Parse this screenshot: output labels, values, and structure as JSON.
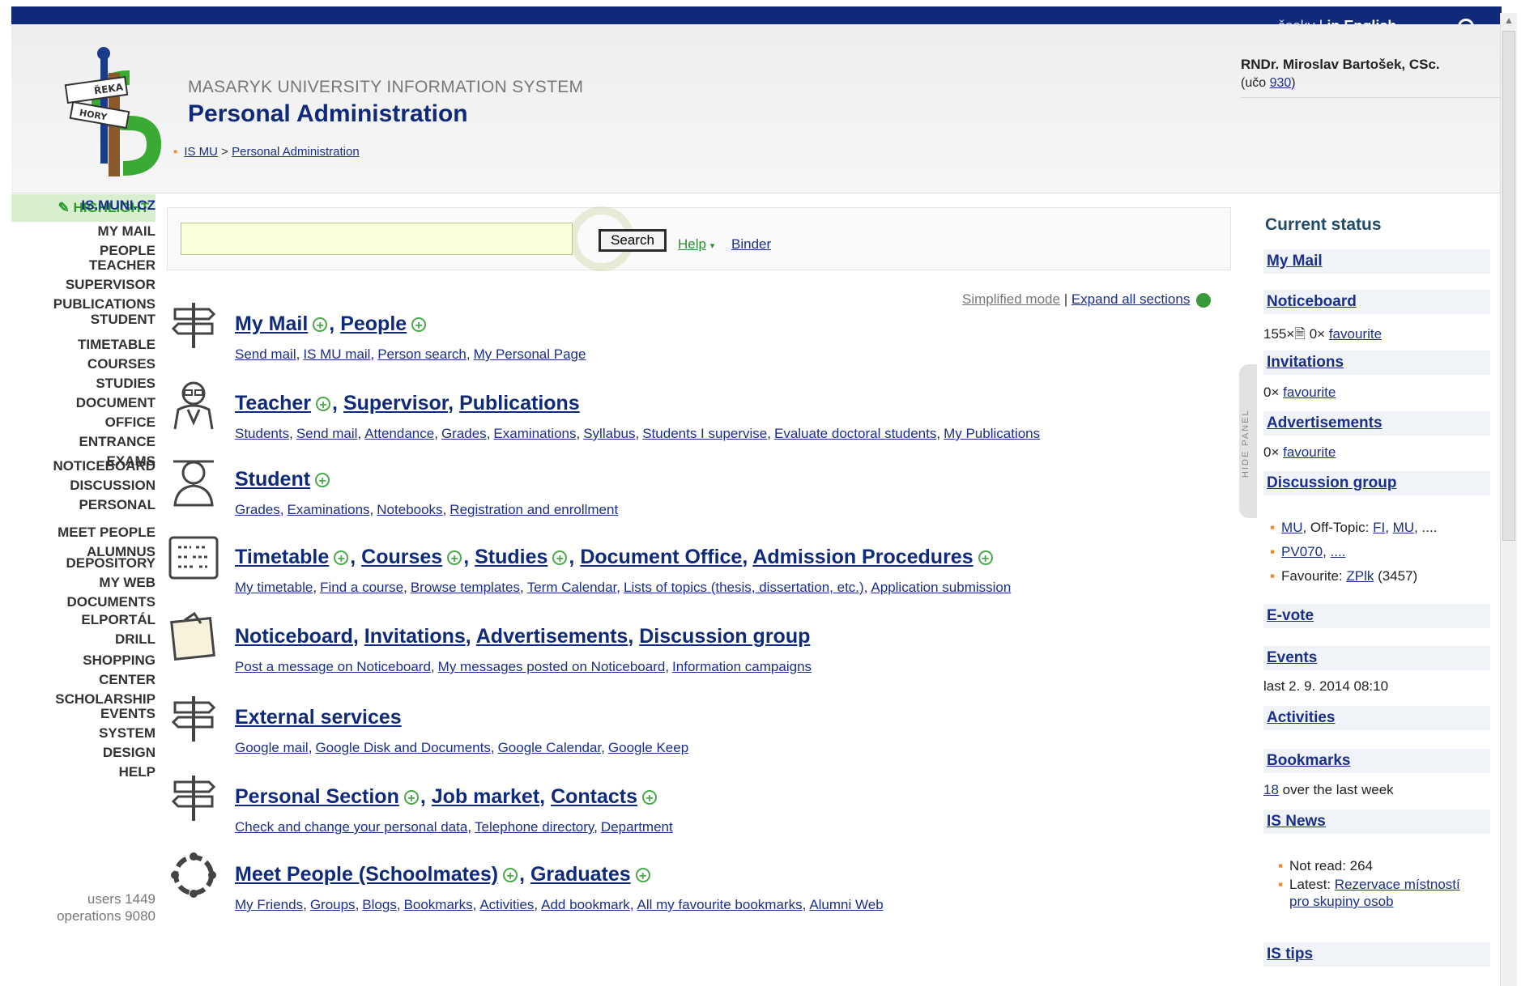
{
  "lang": {
    "czech": "česky",
    "sep": "|",
    "english": "in English"
  },
  "header": {
    "system_title": "MASARYK UNIVERSITY INFORMATION SYSTEM",
    "page_title": "Personal Administration",
    "logo_sign_top": "ŘEKA",
    "logo_sign_bottom": "HORY"
  },
  "breadcrumb": {
    "root": "IS MU",
    "sep": ">",
    "current": "Personal Administration"
  },
  "user": {
    "name": "RNDr. Miroslav Bartošek, CSc.",
    "uco_prefix": "(učo",
    "uco": "930",
    "uco_suffix": ")"
  },
  "leftnav": {
    "highlight": "HIGHLIGHT",
    "groups": [
      [
        "IS.MUNI.CZ"
      ],
      [
        "MY MAIL",
        "PEOPLE"
      ],
      [
        "TEACHER",
        "SUPERVISOR",
        "PUBLICATIONS"
      ],
      [
        "STUDENT"
      ],
      [
        "TIMETABLE",
        "COURSES",
        "STUDIES",
        "DOCUMENT",
        "OFFICE",
        "ENTRANCE",
        "EXAMS"
      ],
      [
        "NOTICEBOARD",
        "DISCUSSION"
      ],
      [
        "PERSONAL"
      ],
      [
        "MEET PEOPLE",
        "ALUMNUS"
      ],
      [
        "DEPOSITORY",
        "MY WEB",
        "DOCUMENTS"
      ],
      [
        "ELPORTÁL",
        "DRILL"
      ],
      [
        "SHOPPING",
        "CENTER",
        "SCHOLARSHIP"
      ],
      [
        "EVENTS",
        "SYSTEM",
        "DESIGN",
        "HELP"
      ]
    ],
    "stats": [
      "users 1449",
      "operations 9080"
    ]
  },
  "search": {
    "placeholder": "",
    "button": "Search",
    "help": "Help",
    "binder": "Binder"
  },
  "mode": {
    "simplified": "Simplified mode",
    "sep": "|",
    "expand": "Expand all sections"
  },
  "sections": [
    {
      "icon": "signpost-icon",
      "titles": [
        {
          "t": "My Mail",
          "plus": true
        },
        {
          "t": "People",
          "plus": true
        }
      ],
      "links": [
        "Send mail",
        "IS MU mail",
        "Person search",
        "My Personal Page"
      ]
    },
    {
      "icon": "teacher-icon",
      "titles": [
        {
          "t": "Teacher",
          "plus": true
        },
        {
          "t": "Supervisor",
          "plus": false
        },
        {
          "t": "Publications",
          "plus": false
        }
      ],
      "links": [
        "Students",
        "Send mail",
        "Attendance",
        "Grades",
        "Examinations",
        "Syllabus",
        "Students I supervise",
        "Evaluate doctoral students",
        "My Publications"
      ]
    },
    {
      "icon": "student-icon",
      "titles": [
        {
          "t": "Student",
          "plus": true
        }
      ],
      "links": [
        "Grades",
        "Examinations",
        "Notebooks",
        "Registration and enrollment"
      ]
    },
    {
      "icon": "timetable-icon",
      "titles": [
        {
          "t": "Timetable",
          "plus": true
        },
        {
          "t": "Courses",
          "plus": true
        },
        {
          "t": "Studies",
          "plus": true
        },
        {
          "t": "Document Office",
          "plus": false
        },
        {
          "t": "Admission Procedures",
          "plus": true
        }
      ],
      "links": [
        "My timetable",
        "Find a course",
        "Browse templates",
        "Term Calendar",
        "Lists of topics (thesis, dissertation, etc.)",
        "Application submission"
      ]
    },
    {
      "icon": "noticeboard-icon",
      "titles": [
        {
          "t": "Noticeboard",
          "plus": false
        },
        {
          "t": "Invitations",
          "plus": false
        },
        {
          "t": "Advertisements",
          "plus": false
        },
        {
          "t": "Discussion group",
          "plus": false
        }
      ],
      "links": [
        "Post a message on Noticeboard",
        "My messages posted on Noticeboard",
        "Information campaigns"
      ]
    },
    {
      "icon": "signpost-icon",
      "titles": [
        {
          "t": "External services",
          "plus": false
        }
      ],
      "links": [
        "Google mail",
        "Google Disk and Documents",
        "Google Calendar",
        "Google Keep"
      ]
    },
    {
      "icon": "signpost-icon",
      "titles": [
        {
          "t": "Personal Section",
          "plus": true
        },
        {
          "t": "Job market",
          "plus": false
        },
        {
          "t": "Contacts",
          "plus": true
        }
      ],
      "links": [
        "Check and change your personal data",
        "Telephone directory",
        "Department"
      ]
    },
    {
      "icon": "people-circle-icon",
      "titles": [
        {
          "t": "Meet People (Schoolmates)",
          "plus": true
        },
        {
          "t": "Graduates",
          "plus": true
        }
      ],
      "links": [
        "My Friends",
        "Groups",
        "Blogs",
        "Bookmarks",
        "Activities",
        "Add bookmark",
        "All my favourite bookmarks",
        "Alumni Web"
      ]
    }
  ],
  "rightpanel": {
    "hide": "HIDE PANEL",
    "title": "Current status",
    "my_mail": "My Mail",
    "noticeboard": "Noticeboard",
    "noticeboard_count": "155×",
    "noticeboard_fav_count": "0×",
    "favourite": "favourite",
    "invitations": "Invitations",
    "invitations_count": "0×",
    "advertisements": "Advertisements",
    "advertisements_count": "0×",
    "discussion": "Discussion group",
    "disc_item1": {
      "a": "MU",
      "mid": ", Off-Topic: ",
      "b": "FI",
      "c": "MU",
      "end": ", ...."
    },
    "disc_item2": {
      "a": "PV070",
      "b": "...."
    },
    "disc_item3": {
      "pre": "Favourite: ",
      "a": "ZPlk",
      "post": " (3457)"
    },
    "evote": "E-vote",
    "events": "Events",
    "events_last": "last 2. 9. 2014 08:10",
    "activities": "Activities",
    "bookmarks": "Bookmarks",
    "bookmarks_count": "18",
    "bookmarks_suffix": " over the last week",
    "isnews": "IS News",
    "not_read": "Not read: 264",
    "latest_pre": "Latest: ",
    "latest_link1": "Rezervace místností",
    "latest_link2": "pro skupiny osob",
    "istips": "IS tips"
  }
}
